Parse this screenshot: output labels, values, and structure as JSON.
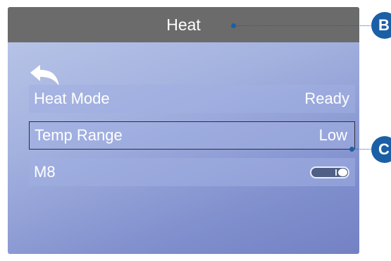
{
  "header": {
    "title": "Heat"
  },
  "back": {
    "icon": "back-arrow-icon"
  },
  "menu": {
    "items": [
      {
        "label": "Heat Mode",
        "value": "Ready"
      },
      {
        "label": "Temp Range",
        "value": "Low"
      },
      {
        "label": "M8",
        "toggle_on": true
      }
    ]
  },
  "callouts": {
    "header_marker": "B",
    "row_marker": "C"
  },
  "colors": {
    "header_bg": "#6b6b6b",
    "accent": "#1b5fa6",
    "row_border": "#2b2f3a"
  }
}
